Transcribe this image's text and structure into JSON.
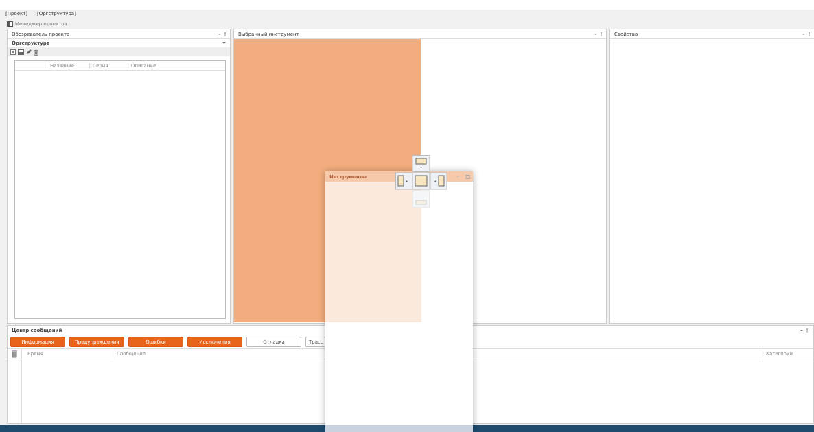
{
  "menu": [
    {
      "label": "[Проект]"
    },
    {
      "label": "[Оргструктура]"
    }
  ],
  "toolbar": {
    "label": "Менеджер проектов"
  },
  "project_explorer": {
    "title": "Обозреватель проекта",
    "section": "Оргструктура",
    "columns": [
      "Название",
      "Серия",
      "Описание"
    ]
  },
  "selected_tool": {
    "title": "Выбранный инструмент"
  },
  "properties": {
    "title": "Свойства"
  },
  "messages": {
    "title": "Центр сообщений",
    "filters": [
      {
        "label": "Информация",
        "on": true
      },
      {
        "label": "Предупреждения",
        "on": true
      },
      {
        "label": "Ошибки",
        "on": true
      },
      {
        "label": "Исключения",
        "on": true
      },
      {
        "label": "Отладка",
        "on": false
      },
      {
        "label": "Трасс",
        "on": false
      }
    ],
    "columns": [
      "Время",
      "Сообщение",
      "Категории"
    ]
  },
  "floating_window": {
    "title": "Инструменты"
  }
}
